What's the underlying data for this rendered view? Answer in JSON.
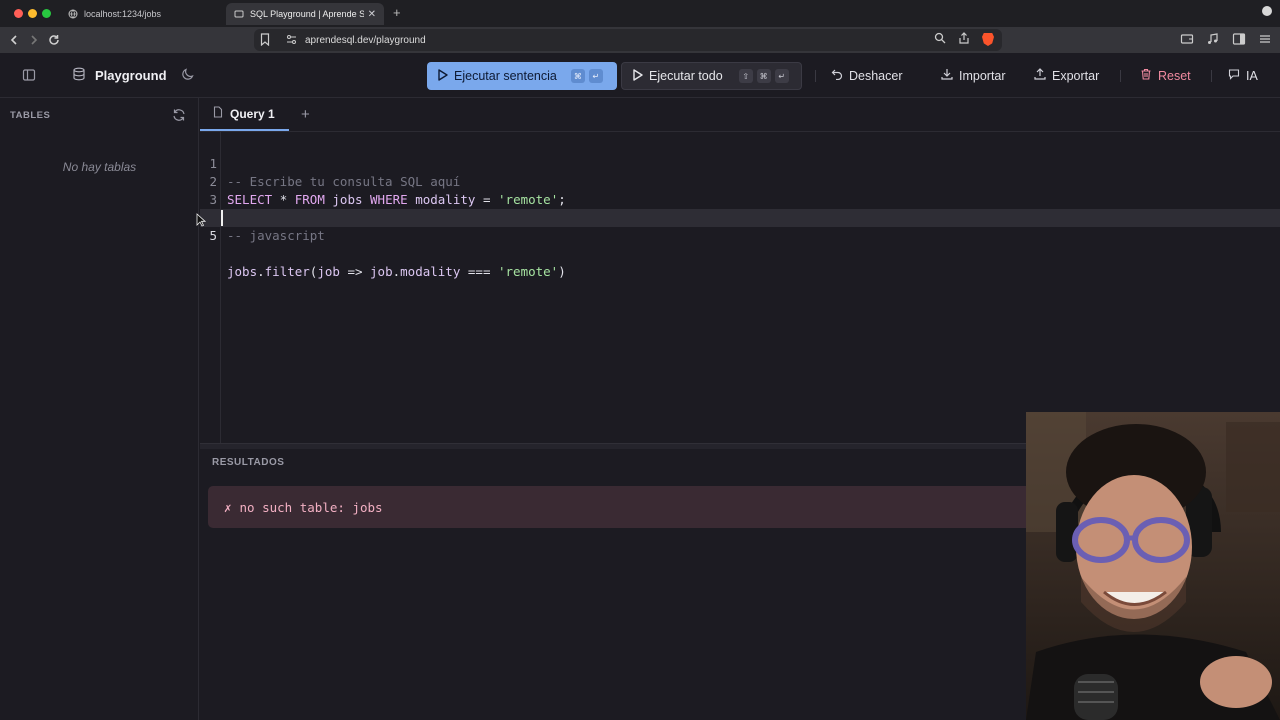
{
  "browser": {
    "tabs": [
      {
        "title": "localhost:1234/jobs"
      },
      {
        "title": "SQL Playground | Aprende SQL"
      }
    ],
    "url": "aprendesql.dev/playground"
  },
  "header": {
    "brand": "Playground",
    "run_statement": {
      "label": "Ejecutar sentencia",
      "keys": [
        "⌘",
        "↵"
      ]
    },
    "run_all": {
      "label": "Ejecutar todo",
      "keys": [
        "⇧",
        "⌘",
        "↵"
      ]
    },
    "undo_label": "Deshacer",
    "import_label": "Importar",
    "export_label": "Exportar",
    "reset_label": "Reset",
    "ai_label": "IA"
  },
  "sidebar": {
    "title": "TABLES",
    "empty_message": "No hay tablas"
  },
  "editor": {
    "tab_label": "Query 1",
    "lines": [
      {
        "n": "1",
        "text": "-- Escribe tu consulta SQL aquí"
      },
      {
        "n": "2",
        "text": "SELECT * FROM jobs WHERE modality = 'remote';"
      },
      {
        "n": "3",
        "text": ""
      },
      {
        "n": "4",
        "text": "-- javascript"
      },
      {
        "n": "5",
        "text": "jobs.filter(job => job.modality === 'remote')"
      }
    ]
  },
  "results": {
    "title": "RESULTADOS",
    "error_symbol": "✗",
    "error_message": "no such table: jobs"
  },
  "colors": {
    "accent": "#7aa8ec",
    "reset": "#f08aa0",
    "error_bg": "#3a2a33",
    "error_text": "#f3b0c3"
  }
}
